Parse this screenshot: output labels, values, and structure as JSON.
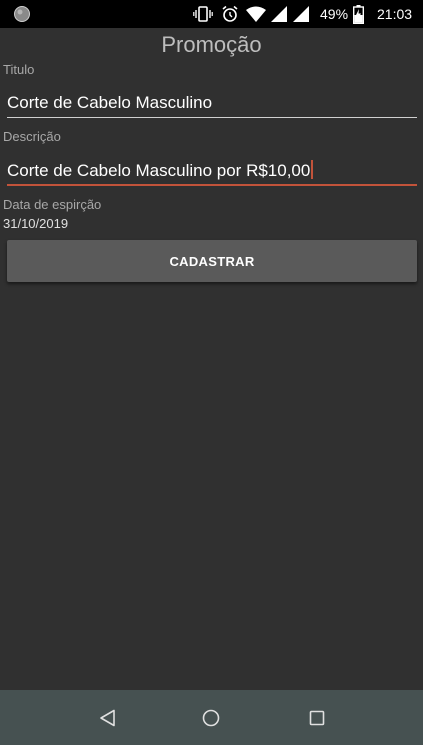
{
  "status_bar": {
    "battery_percent": "49%",
    "time": "21:03",
    "icons": [
      "app-notification-icon",
      "vibrate-icon",
      "alarm-icon",
      "wifi-icon",
      "signal-icon",
      "signal-icon-2",
      "battery-charging-icon"
    ]
  },
  "screen": {
    "title": "Promoção"
  },
  "form": {
    "title_label": "Titulo",
    "title_value": "Corte de Cabelo Masculino",
    "description_label": "Descrição",
    "description_value": "Corte de Cabelo Masculino por R$10,00",
    "expiration_label": "Data de espirção",
    "expiration_value": "31/10/2019",
    "submit_label": "CADASTRAR"
  },
  "nav_bar": {
    "icons": [
      "back-icon",
      "home-icon",
      "recents-icon"
    ]
  },
  "colors": {
    "background": "#303030",
    "accent": "#c2533a",
    "button": "#5a5a5a",
    "nav_bar": "#465151",
    "status_bar": "#000000"
  }
}
